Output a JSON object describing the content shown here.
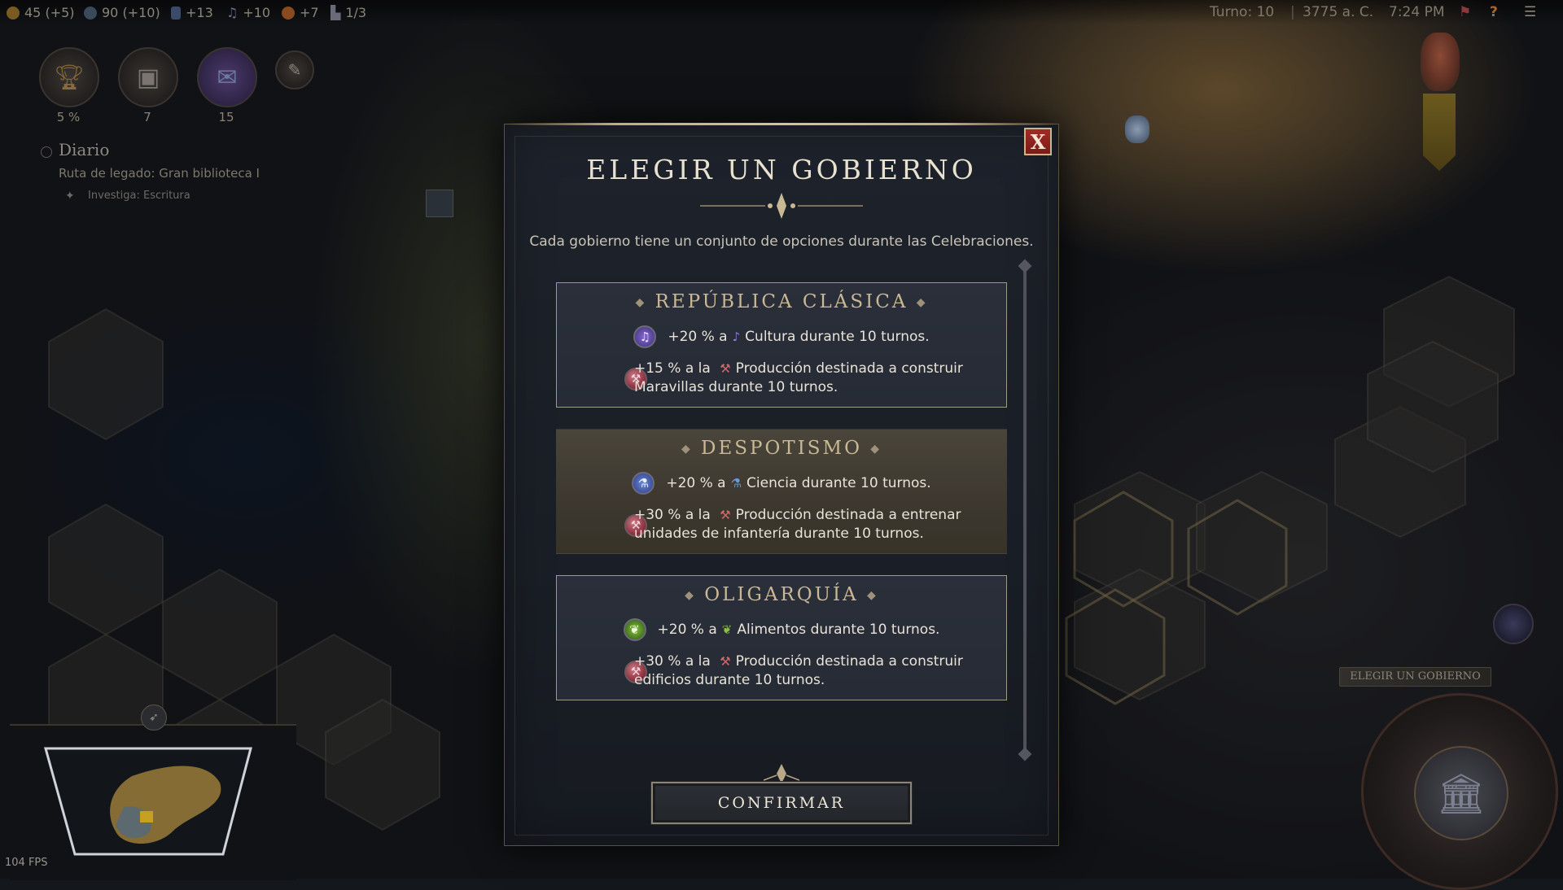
{
  "topbar": {
    "gold": "45 (+5)",
    "influence": "90 (+10)",
    "science": "+13",
    "culture": "+10",
    "happiness": "+7",
    "settlements": "1/3",
    "turn": "Turno: 10",
    "year": "3775 a. C.",
    "time": "7:24 PM"
  },
  "hud": {
    "legacy_percent": "5 %",
    "codex_count": "7",
    "mail_count": "15",
    "journal_title": "Diario",
    "legacy_path": "Ruta de legado: Gran biblioteca I",
    "research": "Investiga: Escritura"
  },
  "dialog": {
    "title": "ELEGIR UN GOBIERNO",
    "subtitle": "Cada gobierno tiene un conjunto de opciones durante las Celebraciones.",
    "close_label": "X",
    "confirm_label": "CONFIRMAR",
    "options": [
      {
        "name": "REPÚBLICA CLÁSICA",
        "bonus1_pre": "+20 % a",
        "bonus1_post": "Cultura durante 10 turnos.",
        "bonus1_icon": "culture-icon",
        "bonus2": "+15 % a la",
        "bonus2_rest": "Producción destinada a construir Maravillas durante 10 turnos."
      },
      {
        "name": "DESPOTISMO",
        "bonus1_pre": "+20 % a",
        "bonus1_post": "Ciencia durante 10 turnos.",
        "bonus1_icon": "science-icon",
        "bonus2": "+30 % a la",
        "bonus2_rest": "Producción destinada a entrenar unidades de infantería durante 10 turnos."
      },
      {
        "name": "OLIGARQUÍA",
        "bonus1_pre": "+20 % a",
        "bonus1_post": "Alimentos durante 10 turnos.",
        "bonus1_icon": "food-icon",
        "bonus2": "+30 % a la",
        "bonus2_rest": "Producción destinada a construir edificios durante 10 turnos."
      }
    ]
  },
  "right_panel": {
    "action_label": "ELEGIR UN GOBIERNO"
  },
  "fps": "104 FPS",
  "colors": {
    "accent_gold": "#c9b894",
    "close_red": "#a32a24",
    "panel_bg": "#1e222b",
    "selected_bg": "#4a453b"
  }
}
